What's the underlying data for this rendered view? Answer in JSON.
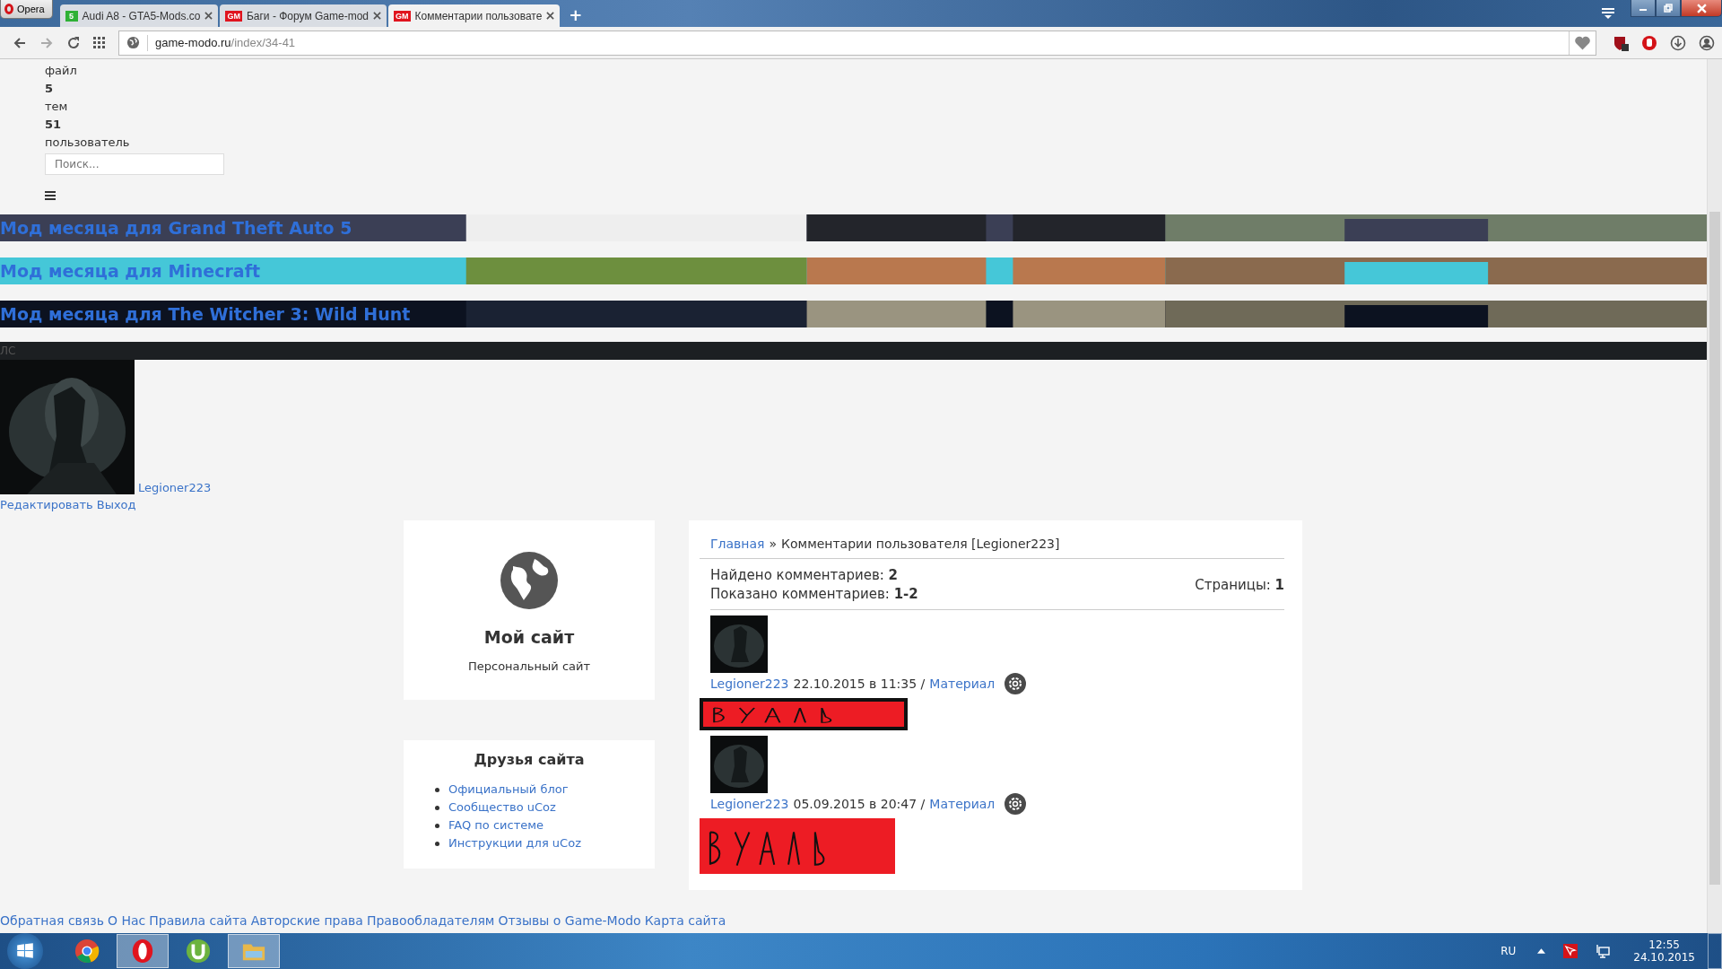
{
  "browser": {
    "menu_label": "Opera",
    "tabs": [
      {
        "badge": "5",
        "color": "#2eb135",
        "label": "Audi A8 - GTA5-Mods.co",
        "selected": false
      },
      {
        "badge": "GM",
        "color": "#e0141e",
        "label": "Баги - Форум Game-mod",
        "selected": false
      },
      {
        "badge": "GM",
        "color": "#e0141e",
        "label": "Комментарии пользовате",
        "selected": true
      }
    ],
    "new_tab": "+",
    "url_domain": "game-modo.ru",
    "url_path": "/index/34-41"
  },
  "stats": [
    {
      "kind": "label",
      "text": "файл"
    },
    {
      "kind": "value",
      "text": "5"
    },
    {
      "kind": "label",
      "text": "тем"
    },
    {
      "kind": "value",
      "text": "51"
    },
    {
      "kind": "label",
      "text": "пользователь"
    }
  ],
  "search": {
    "placeholder": "Поиск..."
  },
  "banners": [
    {
      "title": "Мод месяца для Grand Theft Auto 5"
    },
    {
      "title": "Мод месяца для Minecraft"
    },
    {
      "title": "Мод месяца для The Witcher 3: Wild Hunt"
    }
  ],
  "pm_bar": "ЛС",
  "user": {
    "name": "Legioner223",
    "links": [
      "Редактировать",
      "Выход"
    ]
  },
  "site_card": {
    "title": "Мой сайт",
    "subtitle": "Персональный сайт"
  },
  "friends": {
    "title": "Друзья сайта",
    "links": [
      "Официальный блог",
      "Сообщество uCoz",
      "FAQ по системе",
      "Инструкции для uCoz"
    ]
  },
  "breadcrumb": {
    "home": "Главная",
    "separator": "»",
    "current": "Комментарии пользователя [Legioner223]"
  },
  "summary": {
    "found_label": "Найдено комментариев:",
    "found": "2",
    "shown_label": "Показано комментариев:",
    "shown": "1-2",
    "pages_label": "Страницы:",
    "pages": "1"
  },
  "comments": [
    {
      "author": "Legioner223",
      "date": "22.10.2015 в 11:35 /",
      "link": "Материал",
      "framed": true
    },
    {
      "author": "Legioner223",
      "date": "05.09.2015 в 20:47 /",
      "link": "Материал",
      "framed": false
    }
  ],
  "footer_links": [
    "Обратная связь",
    "О Нас",
    "Правила сайта",
    "Авторские права",
    "Правообладателям",
    "Отзывы о Game-Modo",
    "Карта сайта"
  ],
  "taskbar": {
    "apps": [
      {
        "kind": "chrome",
        "selected": false
      },
      {
        "kind": "opera",
        "selected": true
      },
      {
        "kind": "utorrent",
        "selected": false
      },
      {
        "kind": "folder",
        "selected": true
      }
    ],
    "language": "RU",
    "time": "12:55",
    "date": "24.10.2015"
  }
}
